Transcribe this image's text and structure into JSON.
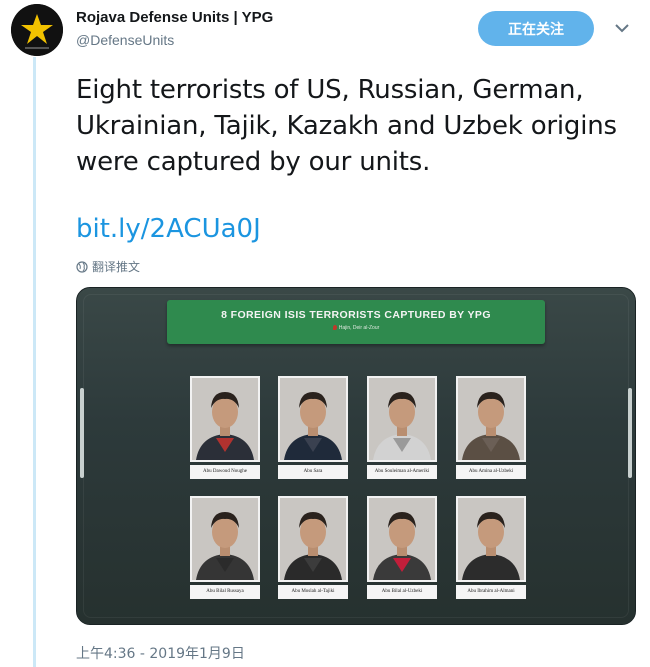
{
  "account": {
    "display_name": "Rojava Defense Units | YPG",
    "handle": "@DefenseUnits",
    "follow_label": "正在关注",
    "avatar_accent": "#f2c200"
  },
  "tweet": {
    "text": "Eight terrorists of US, Russian, German, Ukrainian, Tajik, Kazakh and Uzbek origins were captured by our units.",
    "link": "bit.ly/2ACUa0J",
    "translate_label": "翻译推文",
    "timestamp": "上午4:36 - 2019年1月9日"
  },
  "media": {
    "banner_title": "8 FOREIGN ISIS TERRORISTS CAPTURED BY YPG",
    "banner_subtitle": "Hajin, Deir al-Zour",
    "banner_color": "#2f8a4e",
    "captives": [
      {
        "name": "Abu Dawoud Noughe",
        "shirt": "#b1322f",
        "jacket": "#2b2f38"
      },
      {
        "name": "Abu Sara",
        "shirt": "#3a4150",
        "jacket": "#1f2a3a"
      },
      {
        "name": "Abu Souleiman al-Ameriki",
        "shirt": "#9a9a9a",
        "jacket": "#d2d2d2"
      },
      {
        "name": "Abu Amina al-Uzbeki",
        "shirt": "#6b5f56",
        "jacket": "#5b4f44"
      },
      {
        "name": "Abu Bilal Russaya",
        "shirt": "#2b2b2b",
        "jacket": "#353535"
      },
      {
        "name": "Abu Moslah al-Tajiki",
        "shirt": "#3c3c3c",
        "jacket": "#2a2a2a"
      },
      {
        "name": "Abu Bilal al-Uzbeki",
        "shirt": "#c21e3a",
        "jacket": "#3a3a3a"
      },
      {
        "name": "Abu Ibrahim al-Almani",
        "shirt": "#2c2c2c",
        "jacket": "#2c2c2c"
      }
    ]
  },
  "icons": {
    "caret": "chevron-down-icon",
    "translate": "globe-icon",
    "avatar": "star-icon"
  }
}
